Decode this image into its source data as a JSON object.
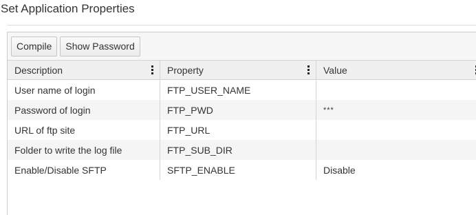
{
  "page": {
    "title": "Set Application Properties"
  },
  "toolbar": {
    "compile_label": "Compile",
    "show_password_label": "Show Password"
  },
  "table": {
    "columns": [
      {
        "label": "Description"
      },
      {
        "label": "Property"
      },
      {
        "label": "Value"
      }
    ],
    "rows": [
      {
        "description": "User name of login",
        "property": "FTP_USER_NAME",
        "value": ""
      },
      {
        "description": "Password of login",
        "property": "FTP_PWD",
        "value": "***"
      },
      {
        "description": "URL of ftp site",
        "property": "FTP_URL",
        "value": ""
      },
      {
        "description": "Folder to write the log file",
        "property": "FTP_SUB_DIR",
        "value": ""
      },
      {
        "description": "Enable/Disable SFTP",
        "property": "SFTP_ENABLE",
        "value": "Disable"
      }
    ]
  },
  "icons": {
    "column_menu": "vertical-dots-icon"
  },
  "colors": {
    "header_bg": "#f0f0f0",
    "stripe_bg": "#f5f5f5",
    "border": "#d4d4d4",
    "text": "#333333"
  }
}
